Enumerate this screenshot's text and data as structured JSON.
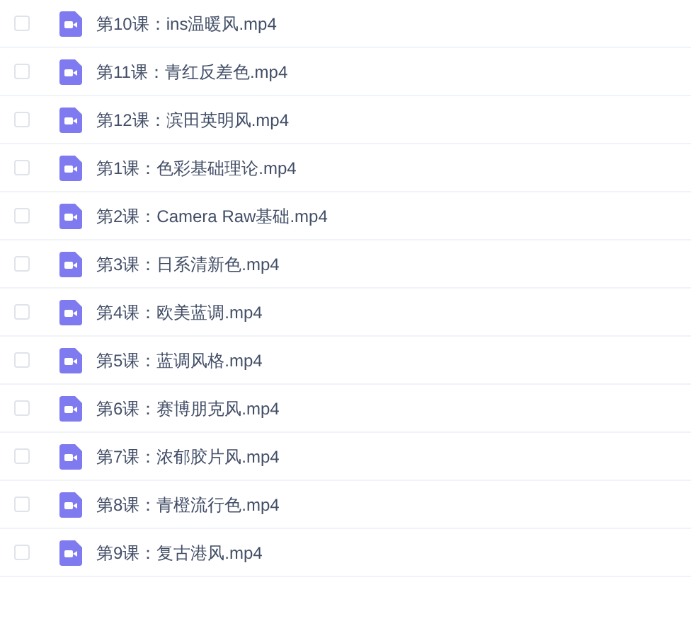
{
  "files": [
    {
      "name": "第10课：ins温暖风.mp4",
      "checked": false
    },
    {
      "name": "第11课：青红反差色.mp4",
      "checked": false
    },
    {
      "name": "第12课：滨田英明风.mp4",
      "checked": false
    },
    {
      "name": "第1课：色彩基础理论.mp4",
      "checked": false
    },
    {
      "name": "第2课：Camera Raw基础.mp4",
      "checked": false
    },
    {
      "name": "第3课：日系清新色.mp4",
      "checked": false
    },
    {
      "name": "第4课：欧美蓝调.mp4",
      "checked": false
    },
    {
      "name": "第5课：蓝调风格.mp4",
      "checked": false
    },
    {
      "name": "第6课：赛博朋克风.mp4",
      "checked": false
    },
    {
      "name": "第7课：浓郁胶片风.mp4",
      "checked": false
    },
    {
      "name": "第8课：青橙流行色.mp4",
      "checked": false
    },
    {
      "name": "第9课：复古港风.mp4",
      "checked": false
    }
  ]
}
